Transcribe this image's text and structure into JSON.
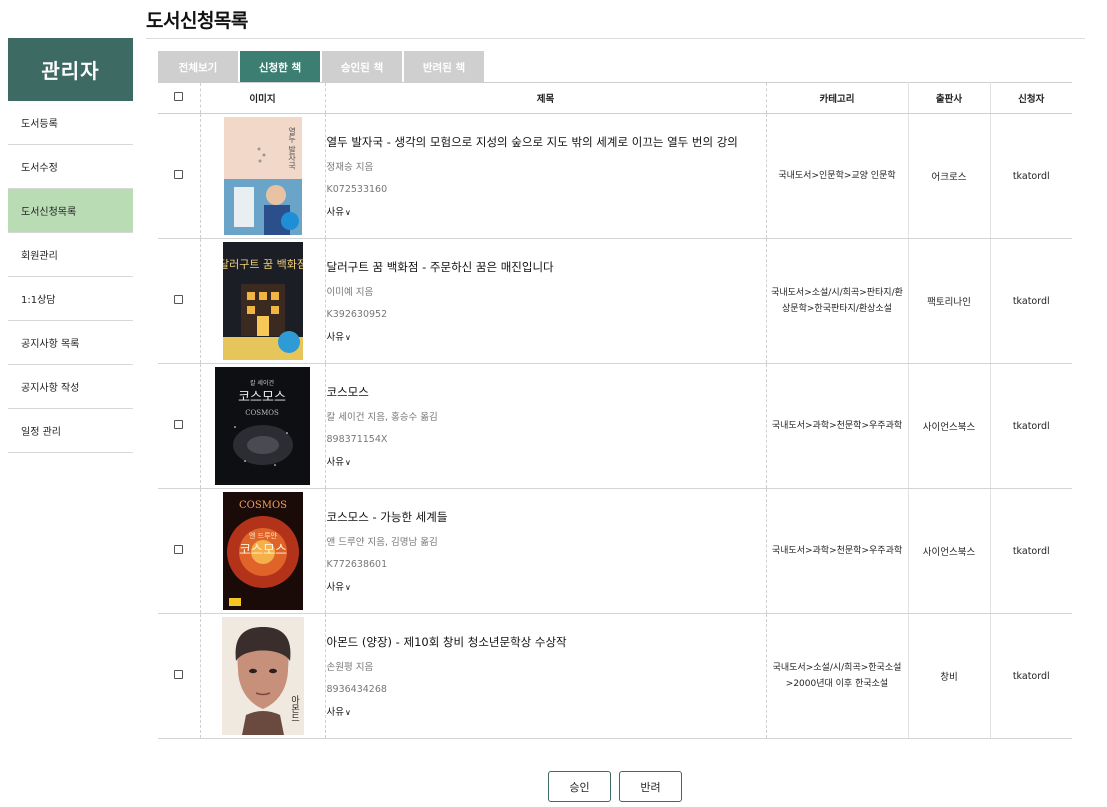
{
  "page_title": "도서신청목록",
  "sidebar": {
    "header": "관리자",
    "items": [
      {
        "label": "도서등록"
      },
      {
        "label": "도서수정"
      },
      {
        "label": "도서신청목록"
      },
      {
        "label": "회원관리"
      },
      {
        "label": "1:1상담"
      },
      {
        "label": "공지사항 목록"
      },
      {
        "label": "공지사항 작성"
      },
      {
        "label": "일정 관리"
      }
    ]
  },
  "tabs": [
    "전체보기",
    "신청한 책",
    "승인된 책",
    "반려된 책"
  ],
  "table": {
    "headers": {
      "image": "이미지",
      "title": "제목",
      "category": "카테고리",
      "publisher": "출판사",
      "applicant": "신청자"
    },
    "rows": [
      {
        "title": "열두 발자국 - 생각의 모험으로 지성의 숲으로 지도 밖의 세계로 이끄는 열두 번의 강의",
        "author": "정재승 지음",
        "id": "K072533160",
        "reason": "사유",
        "category": "국내도서>인문학>교양 인문학",
        "publisher": "어크로스",
        "applicant": "tkatordl",
        "cover_title": "열두 발자국"
      },
      {
        "title": "달러구트 꿈 백화점 - 주문하신 꿈은 매진입니다",
        "author": "이미예 지음",
        "id": "K392630952",
        "reason": "사유",
        "category": "국내도서>소설/시/희곡>판타지/환상문학>한국판타지/환상소설",
        "publisher": "팩토리나인",
        "applicant": "tkatordl",
        "cover_title": "달러구트 꿈 백화점"
      },
      {
        "title": "코스모스",
        "author": "칼 세이건 지음, 홍승수 옮김",
        "id": "898371154X",
        "reason": "사유",
        "category": "국내도서>과학>천문학>우주과학",
        "publisher": "사이언스북스",
        "applicant": "tkatordl",
        "cover_title": "코스모스",
        "cover_sub": "칼 세이건",
        "cover_en": "COSMOS"
      },
      {
        "title": "코스모스 - 가능한 세계들",
        "author": "앤 드루얀 지음, 김명남 옮김",
        "id": "K772638601",
        "reason": "사유",
        "category": "국내도서>과학>천문학>우주과학",
        "publisher": "사이언스북스",
        "applicant": "tkatordl",
        "cover_title": "코스모스",
        "cover_sub": "앤 드루얀",
        "cover_en": "COSMOS"
      },
      {
        "title": "아몬드 (양장) - 제10회 창비 청소년문학상 수상작",
        "author": "손원평 지음",
        "id": "8936434268",
        "reason": "사유",
        "category": "국내도서>소설/시/희곡>한국소설>2000년대 이후 한국소설",
        "publisher": "창비",
        "applicant": "tkatordl",
        "cover_title": "아몬드"
      }
    ]
  },
  "buttons": {
    "approve": "승인",
    "reject": "반려"
  }
}
